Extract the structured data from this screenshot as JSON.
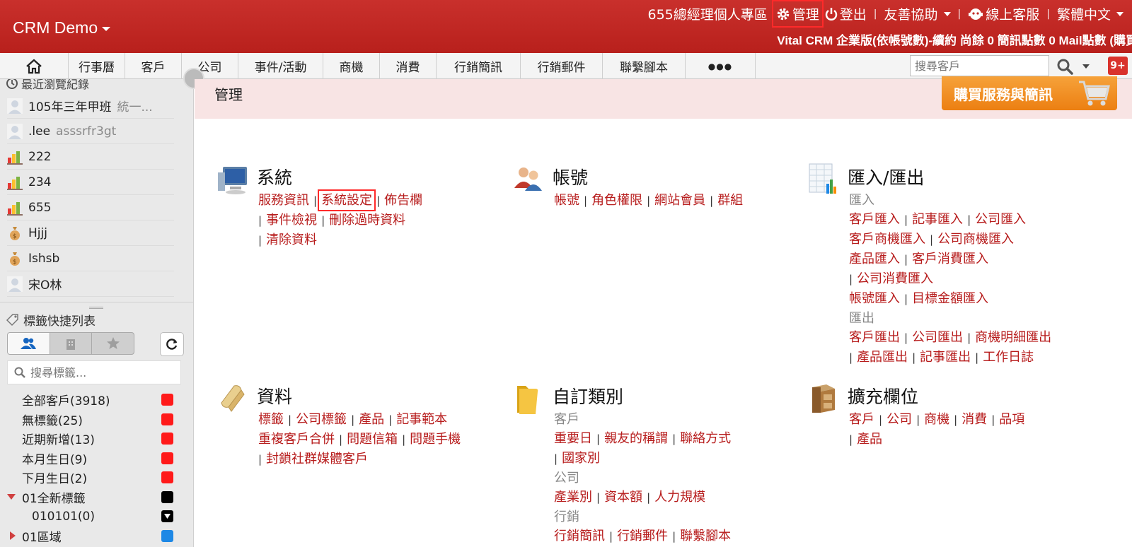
{
  "header": {
    "brand": "CRM Demo",
    "nav": {
      "personal": "655總經理個人專區",
      "admin": "管理",
      "logout": "登出",
      "friendly_help": "友善協助",
      "online_service": "線上客服",
      "language": "繁體中文"
    },
    "subinfo": "Vital CRM 企業版(依帳號數)-續約 尚餘 0 簡訊點數 0 Mail點數 (購買"
  },
  "tabs": [
    "行事曆",
    "客戶",
    "公司",
    "事件/活動",
    "商機",
    "消費",
    "行銷簡訊",
    "行銷郵件",
    "聯繫腳本",
    "●●●"
  ],
  "search": {
    "placeholder": "搜尋客戶"
  },
  "notification_badge": "9+",
  "sidebar": {
    "recent_title": "最近瀏覽紀錄",
    "recent": [
      {
        "name": "105年三年甲班",
        "sub": "統一...",
        "icon": "person-icon"
      },
      {
        "name": ".lee",
        "sub": "asssrfr3gt",
        "icon": "person-icon"
      },
      {
        "name": "222",
        "sub": "",
        "icon": "chart-icon"
      },
      {
        "name": "234",
        "sub": "",
        "icon": "chart-icon"
      },
      {
        "name": "655",
        "sub": "",
        "icon": "chart-icon"
      },
      {
        "name": "Hjjj",
        "sub": "",
        "icon": "moneybag-icon"
      },
      {
        "name": "Ishsb",
        "sub": "",
        "icon": "moneybag-icon"
      },
      {
        "name": "宋O林",
        "sub": "",
        "icon": "person-icon"
      }
    ],
    "tag_title": "標籤快捷列表",
    "tag_search_placeholder": "搜尋標籤...",
    "tags": [
      {
        "label": "全部客戶(3918)",
        "color": "#ff1a1a"
      },
      {
        "label": "無標籤(25)",
        "color": "#ff1a1a"
      },
      {
        "label": "近期新增(13)",
        "color": "#ff1a1a"
      },
      {
        "label": "本月生日(9)",
        "color": "#ff1a1a"
      },
      {
        "label": "下月生日(2)",
        "color": "#ff1a1a"
      },
      {
        "label": "01全新標籤",
        "color": "#000000"
      },
      {
        "label": "010101(0)",
        "color": "#000000"
      },
      {
        "label": "01區域",
        "color": "#1e88e5"
      }
    ]
  },
  "main": {
    "title": "管理",
    "buy_button": "購買服務與簡訊",
    "system": {
      "title": "系統",
      "links": [
        "服務資訊",
        "系統設定",
        "佈告欄",
        "事件檢視",
        "刪除過時資料",
        "清除資料"
      ]
    },
    "account": {
      "title": "帳號",
      "links": [
        "帳號",
        "角色權限",
        "網站會員",
        "群組"
      ]
    },
    "importexport": {
      "title": "匯入/匯出",
      "import_label": "匯入",
      "import_links": [
        "客戶匯入",
        "記事匯入",
        "公司匯入",
        "客戶商機匯入",
        "公司商機匯入",
        "產品匯入",
        "客戶消費匯入",
        "公司消費匯入",
        "帳號匯入",
        "目標金額匯入"
      ],
      "export_label": "匯出",
      "export_links": [
        "客戶匯出",
        "公司匯出",
        "商機明細匯出",
        "產品匯出",
        "記事匯出",
        "工作日誌"
      ]
    },
    "data": {
      "title": "資料",
      "links": [
        "標籤",
        "公司標籤",
        "產品",
        "記事範本",
        "重複客戶合併",
        "問題信箱",
        "問題手機",
        "封鎖社群媒體客戶"
      ]
    },
    "custom": {
      "title": "自訂類別",
      "customer_label": "客戶",
      "customer_links": [
        "重要日",
        "親友的稱謂",
        "聯絡方式",
        "國家別"
      ],
      "company_label": "公司",
      "company_links": [
        "產業別",
        "資本額",
        "人力規模"
      ],
      "marketing_label": "行銷",
      "marketing_links": [
        "行銷簡訊",
        "行銷郵件",
        "聯繫腳本"
      ]
    },
    "fields": {
      "title": "擴充欄位",
      "links": [
        "客戶",
        "公司",
        "商機",
        "消費",
        "品項",
        "產品"
      ]
    }
  }
}
